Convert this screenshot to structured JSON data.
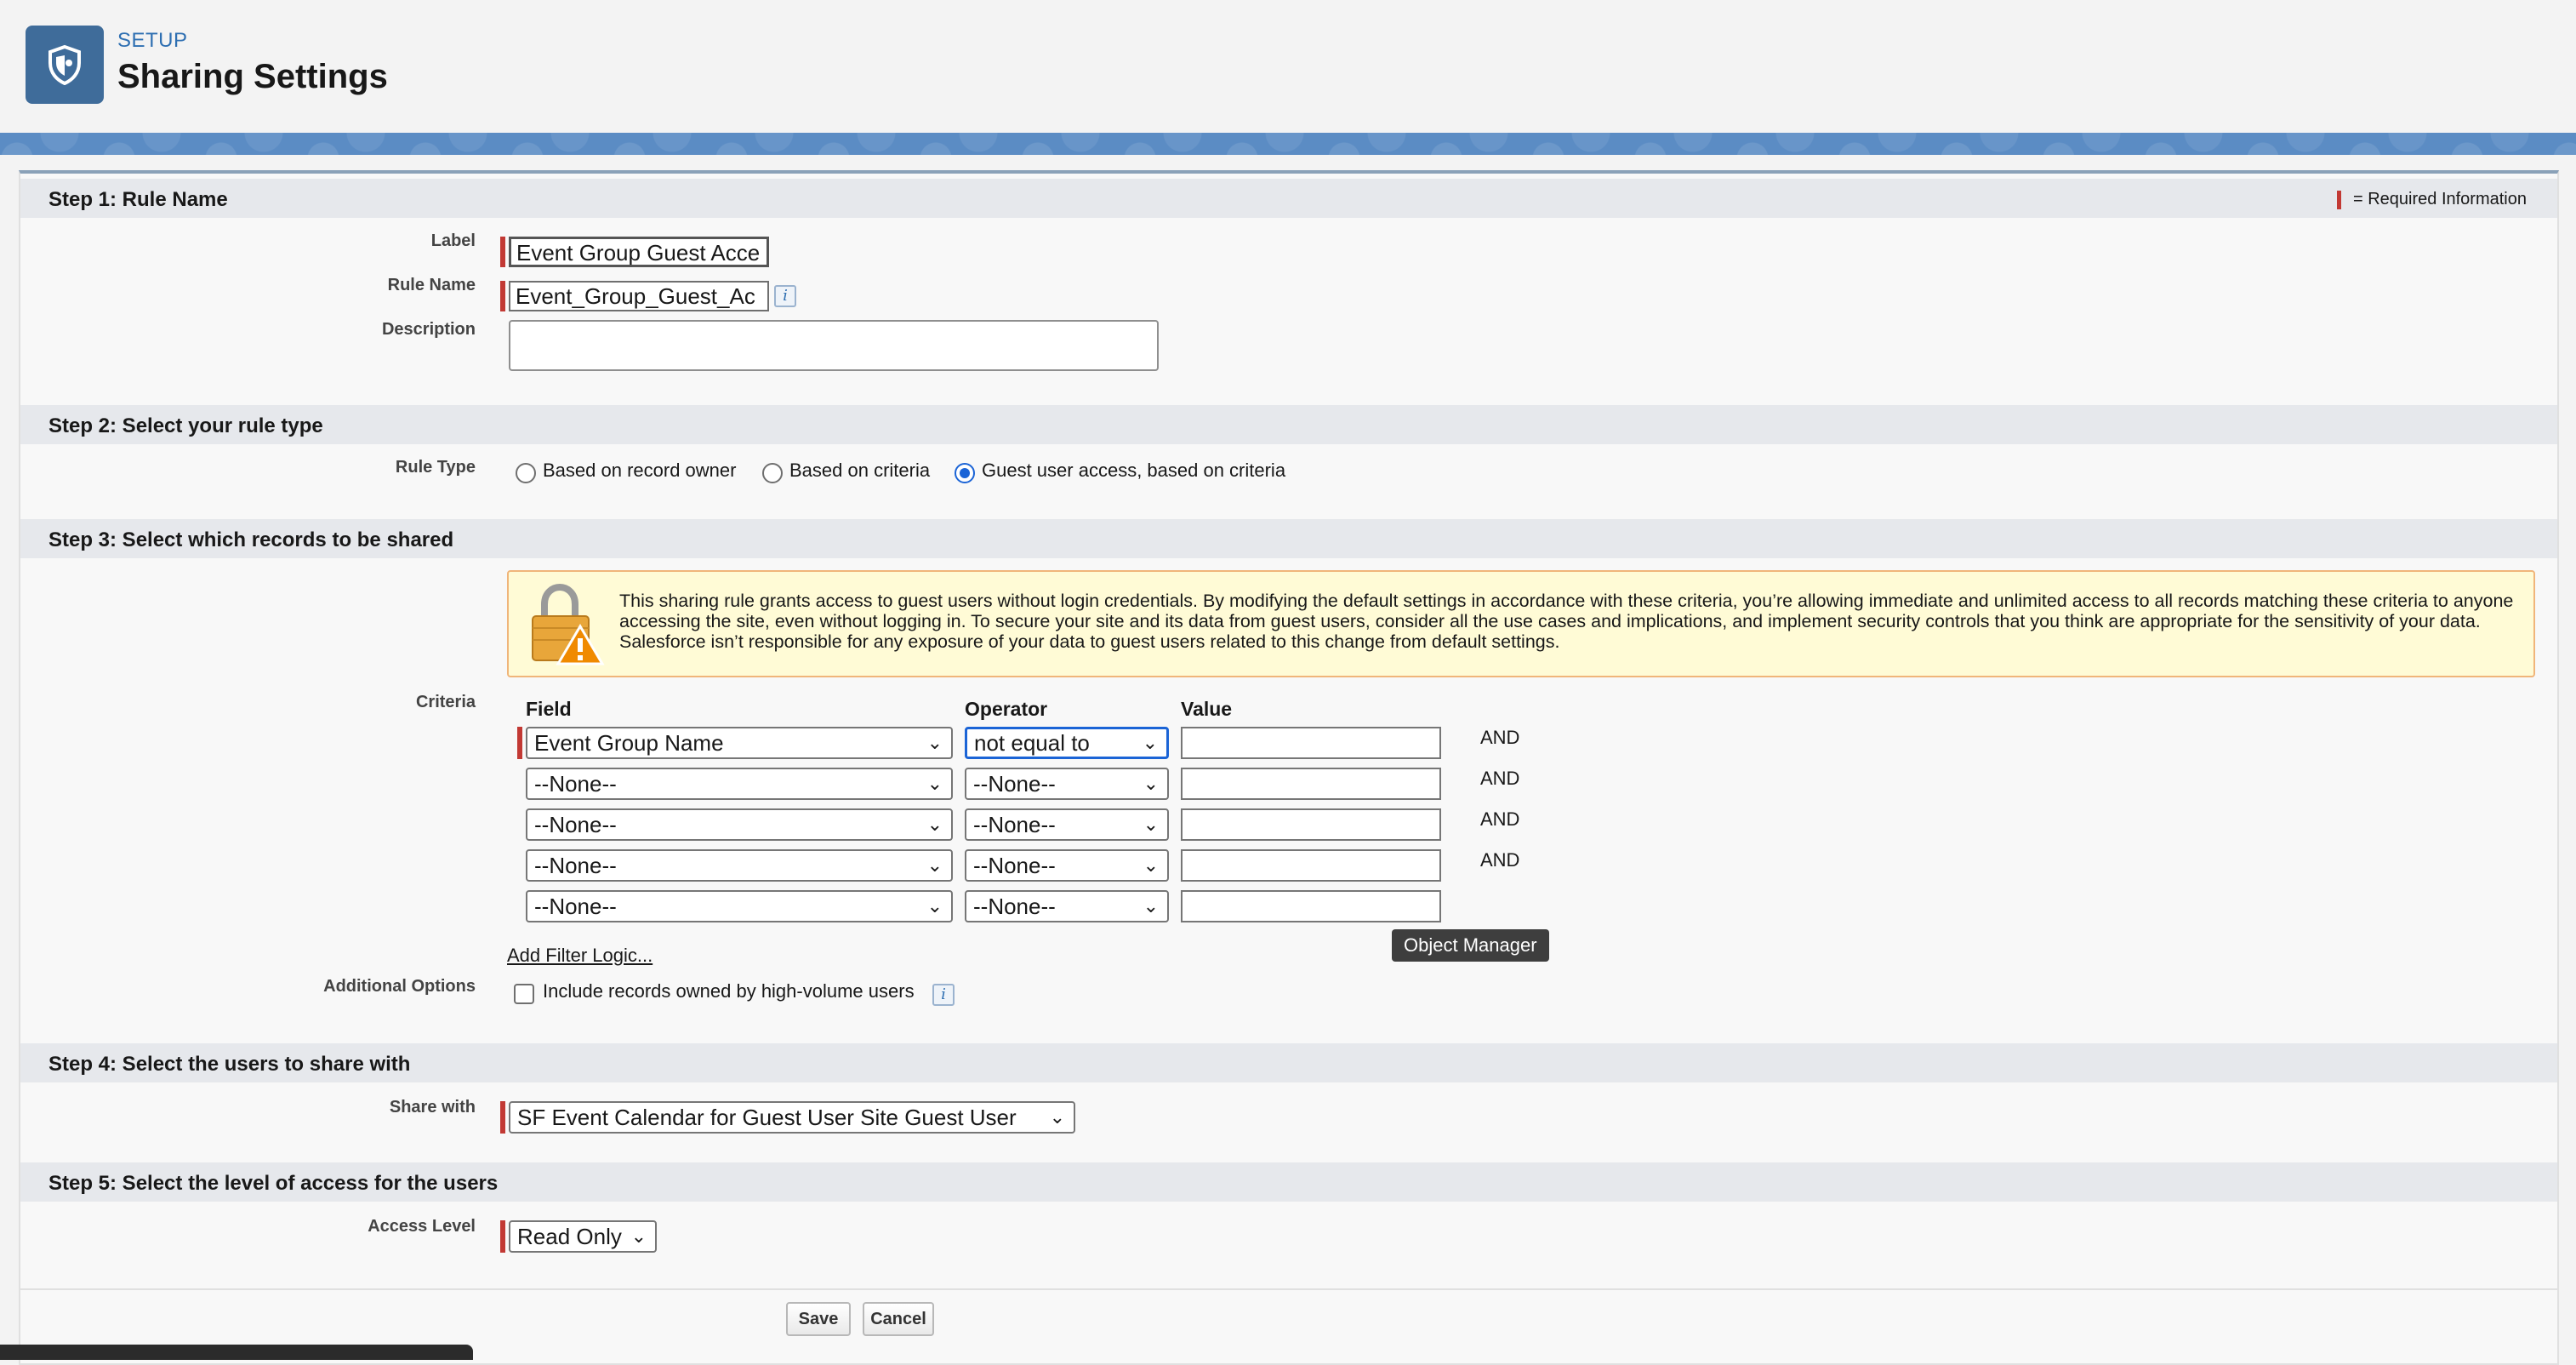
{
  "header": {
    "setup_label": "SETUP",
    "page_title": "Sharing Settings",
    "icon": "shield-icon"
  },
  "required_info": "= Required Information",
  "step1": {
    "title": "Step 1: Rule Name",
    "label_field": {
      "label": "Label",
      "value": "Event Group Guest Acce"
    },
    "rule_name_field": {
      "label": "Rule Name",
      "value": "Event_Group_Guest_Ac"
    },
    "description_field": {
      "label": "Description",
      "value": ""
    }
  },
  "step2": {
    "title": "Step 2: Select your rule type",
    "label": "Rule Type",
    "options": [
      {
        "label": "Based on record owner",
        "checked": false
      },
      {
        "label": "Based on criteria",
        "checked": false
      },
      {
        "label": "Guest user access, based on criteria",
        "checked": true
      }
    ]
  },
  "step3": {
    "title": "Step 3: Select which records to be shared",
    "warning": "This sharing rule grants access to guest users without login credentials. By modifying the default settings in accordance with these criteria, you’re allowing immediate and unlimited access to all records matching these criteria to anyone accessing the site, even without logging in. To secure your site and its data from guest users, consider all the use cases and implications, and implement security controls that you think are appropriate for the sensitivity of your data. Salesforce isn’t responsible for any exposure of your data to guest users related to this change from default settings.",
    "criteria_label": "Criteria",
    "columns": {
      "field": "Field",
      "operator": "Operator",
      "value": "Value"
    },
    "rows": [
      {
        "field": "Event Group Name",
        "operator": "not equal to",
        "value": "",
        "conj": "AND"
      },
      {
        "field": "--None--",
        "operator": "--None--",
        "value": "",
        "conj": "AND"
      },
      {
        "field": "--None--",
        "operator": "--None--",
        "value": "",
        "conj": "AND"
      },
      {
        "field": "--None--",
        "operator": "--None--",
        "value": "",
        "conj": "AND"
      },
      {
        "field": "--None--",
        "operator": "--None--",
        "value": "",
        "conj": ""
      }
    ],
    "add_filter_logic": "Add Filter Logic...",
    "tooltip": "Object Manager",
    "additional_options_label": "Additional Options",
    "include_high_volume": {
      "label": "Include records owned by high-volume users",
      "checked": false
    }
  },
  "step4": {
    "title": "Step 4: Select the users to share with",
    "label": "Share with",
    "value": "SF Event Calendar for Guest User Site Guest User"
  },
  "step5": {
    "title": "Step 5: Select the level of access for the users",
    "label": "Access Level",
    "value": "Read Only"
  },
  "buttons": {
    "save": "Save",
    "cancel": "Cancel"
  },
  "colors": {
    "required": "#c23934",
    "accent": "#1b64d6",
    "header_icon_bg": "#3f6c9a"
  }
}
